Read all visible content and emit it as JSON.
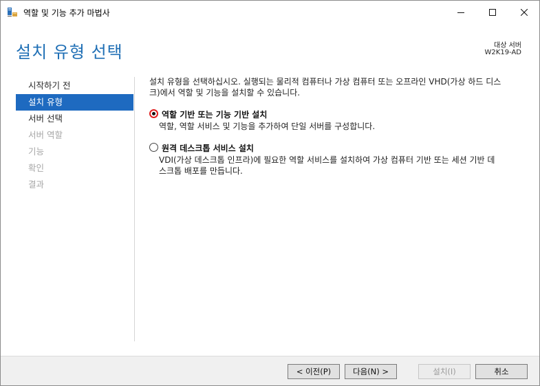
{
  "window": {
    "title": "역할 및 기능 추가 마법사"
  },
  "header": {
    "page_title": "설치 유형 선택",
    "target_label": "대상 서버",
    "target_name": "W2K19-AD"
  },
  "nav": {
    "items": [
      {
        "label": "시작하기 전",
        "state": "normal"
      },
      {
        "label": "설치 유형",
        "state": "active"
      },
      {
        "label": "서버 선택",
        "state": "normal"
      },
      {
        "label": "서버 역할",
        "state": "disabled"
      },
      {
        "label": "기능",
        "state": "disabled"
      },
      {
        "label": "확인",
        "state": "disabled"
      },
      {
        "label": "결과",
        "state": "disabled"
      }
    ]
  },
  "main": {
    "intro_line1": "설치 유형을 선택하십시오. 실행되는 물리적 컴퓨터나 가상 컴퓨터 또는 오프라인 VHD(가상 하드 디스",
    "intro_line2": "크)에서 역할 및 기능을 설치할 수 있습니다.",
    "options": [
      {
        "label": "역할 기반 또는 기능 기반 설치",
        "desc_line1": "역할, 역할 서비스 및 기능을 추가하여 단일 서버를 구성합니다.",
        "desc_line2": "",
        "selected": true
      },
      {
        "label": "원격 데스크톱 서비스 설치",
        "desc_line1": "VDI(가상 데스크톱 인프라)에 필요한 역할 서비스를 설치하여 가상 컴퓨터 기반 또는 세션 기반 데",
        "desc_line2": "스크톱 배포를 만듭니다.",
        "selected": false
      }
    ]
  },
  "footer": {
    "prev_label": "< 이전(P)",
    "next_label": "다음(N) >",
    "install_label": "설치(I)",
    "cancel_label": "취소"
  },
  "colors": {
    "accent": "#1e6ac0",
    "title": "#1f6fb5",
    "radio_highlight": "#e02020"
  },
  "icons": {
    "app": "server-manager-icon",
    "minimize": "minimize-icon",
    "maximize": "maximize-icon",
    "close": "close-icon"
  }
}
